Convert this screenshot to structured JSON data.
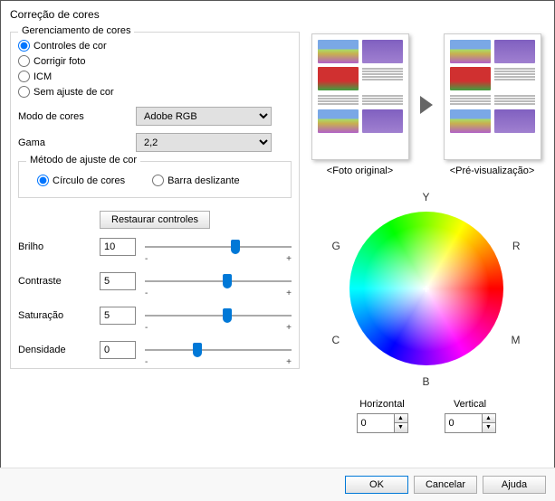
{
  "title": "Correção de cores",
  "group_mgmt": {
    "title": "Gerenciamento de cores",
    "controls": "Controles de cor",
    "fix_photo": "Corrigir foto",
    "icm": "ICM",
    "none": "Sem ajuste de cor"
  },
  "color_mode": {
    "label": "Modo de cores",
    "value": "Adobe RGB"
  },
  "gamma": {
    "label": "Gama",
    "value": "2,2"
  },
  "method": {
    "title": "Método de ajuste de cor",
    "circle": "Círculo de cores",
    "slider": "Barra deslizante"
  },
  "restore": "Restaurar controles",
  "brightness": {
    "label": "Brilho",
    "value": "10",
    "pct": 62
  },
  "contrast": {
    "label": "Contraste",
    "value": "5",
    "pct": 56
  },
  "saturation": {
    "label": "Saturação",
    "value": "5",
    "pct": 56
  },
  "density": {
    "label": "Densidade",
    "value": "0",
    "pct": 36
  },
  "preview": {
    "original": "<Foto original>",
    "preview": "<Pré-visualização>"
  },
  "wheel": {
    "Y": "Y",
    "G": "G",
    "R": "R",
    "C": "C",
    "M": "M",
    "B": "B"
  },
  "hv": {
    "horizontal": "Horizontal",
    "vertical": "Vertical",
    "h_val": "0",
    "v_val": "0"
  },
  "buttons": {
    "ok": "OK",
    "cancel": "Cancelar",
    "help": "Ajuda"
  },
  "marks": {
    "minus": "-",
    "plus": "+"
  }
}
